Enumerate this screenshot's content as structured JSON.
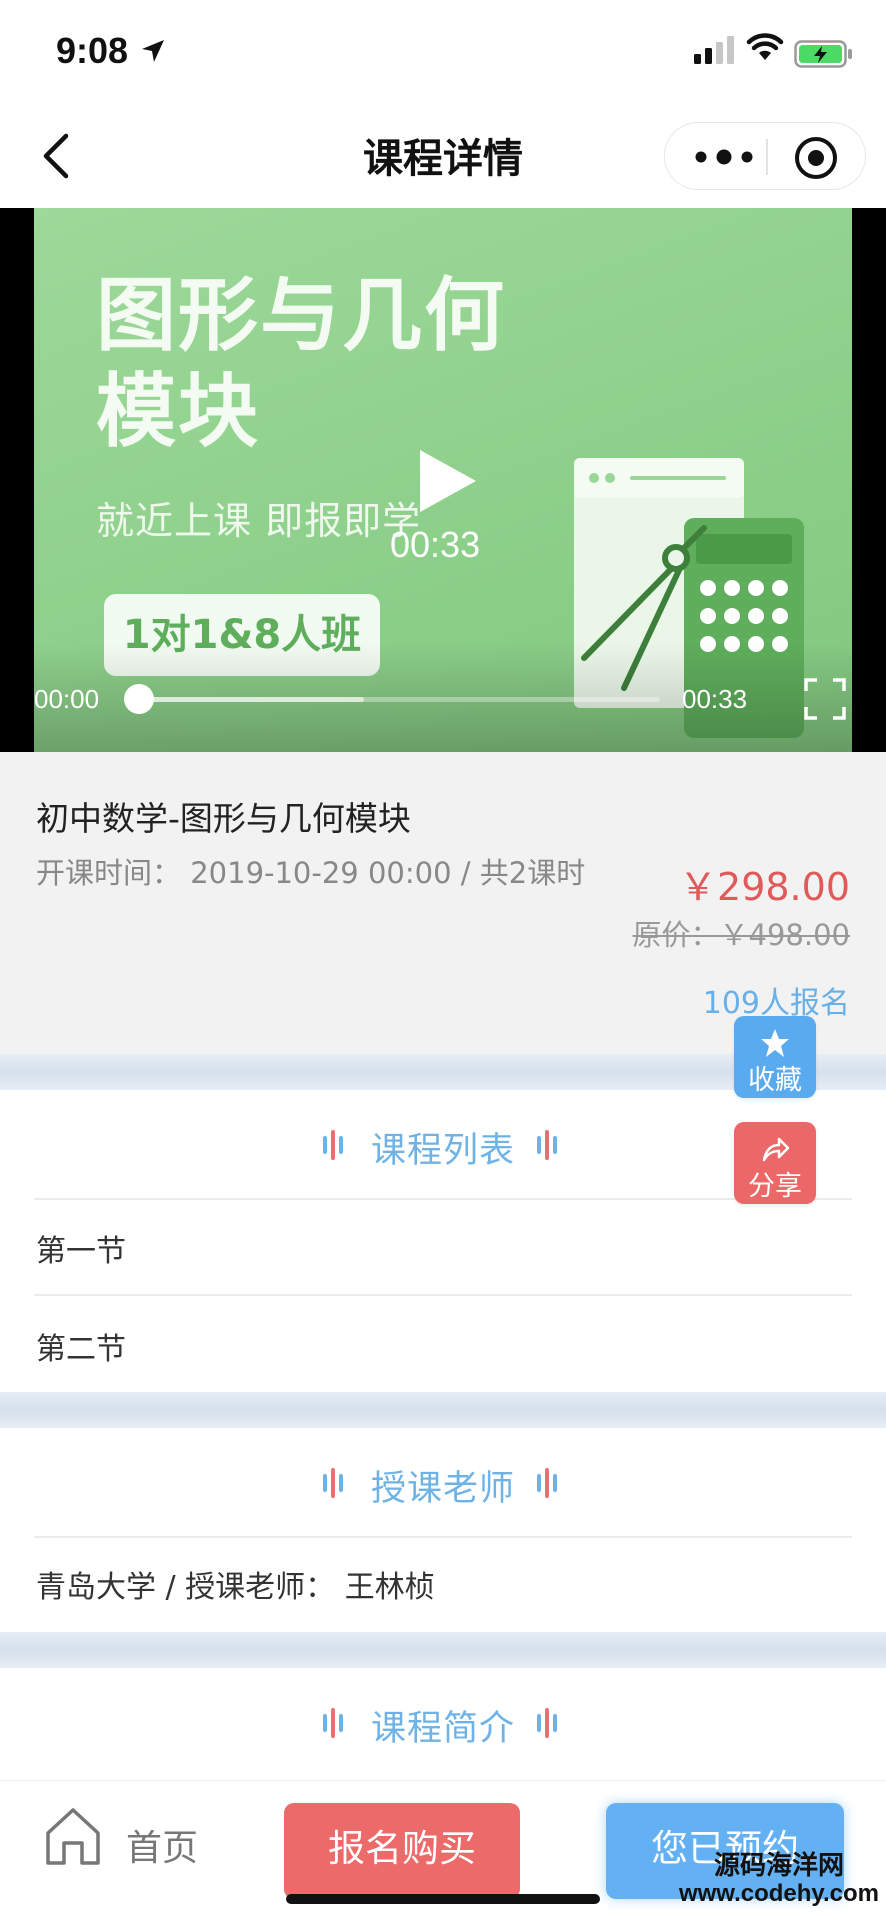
{
  "status_bar": {
    "time": "9:08"
  },
  "nav": {
    "title": "课程详情"
  },
  "video": {
    "cover_title_line1": "图形与几何",
    "cover_title_line2": "模块",
    "cover_subtitle": "就近上课 即报即学",
    "cover_badge": "1对1&8人班",
    "center_time": "00:33",
    "current_time": "00:00",
    "duration": "00:33",
    "buffered_fraction": 0.43
  },
  "course": {
    "name": "初中数学-图形与几何模块",
    "meta": "开课时间： 2019-10-29 00:00 / 共2课时",
    "price": "￥298.00",
    "original_price": "原价：￥498.00",
    "signup_count": "109人报名"
  },
  "float_buttons": {
    "favorite": "收藏",
    "share": "分享"
  },
  "sections": {
    "lessons": {
      "title": "课程列表",
      "items": [
        "第一节",
        "第二节"
      ]
    },
    "teacher": {
      "title": "授课老师",
      "text": "青岛大学 / 授课老师：  王林桢"
    },
    "intro": {
      "title": "课程简介"
    }
  },
  "bottom_bar": {
    "home_label": "首页",
    "buy_label": "报名购买",
    "booked_label": "您已预约"
  },
  "watermark": {
    "line1": "源码海洋网",
    "line2": "www.codehy.com"
  },
  "colors": {
    "accent_blue": "#6fb3e6",
    "price_red": "#e05a5a",
    "buy_red": "#ec6a6a",
    "booked_blue": "#63b1f2",
    "cover_green": "#8fd18c"
  }
}
